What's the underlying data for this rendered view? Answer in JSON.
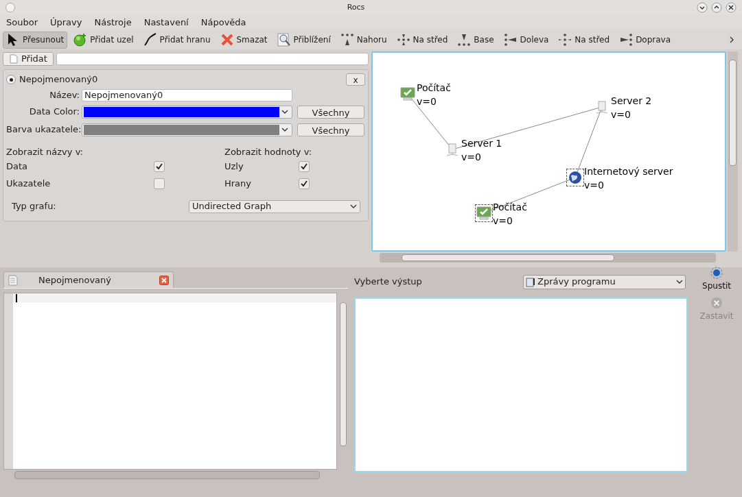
{
  "window": {
    "title": "Rocs"
  },
  "menu": [
    "Soubor",
    "Úpravy",
    "Nástroje",
    "Nastavení",
    "Nápověda"
  ],
  "toolbar": [
    {
      "label": "Přesunout",
      "kind": "pointer",
      "selected": true
    },
    {
      "label": "Přidat uzel",
      "kind": "add-node",
      "selected": false
    },
    {
      "label": "Přidat hranu",
      "kind": "add-edge",
      "selected": false
    },
    {
      "label": "Smazat",
      "kind": "delete",
      "selected": false
    },
    {
      "label": "Přiblížení",
      "kind": "zoom",
      "selected": false
    },
    {
      "label": "Nahoru",
      "kind": "align-top",
      "selected": false
    },
    {
      "label": "Na střed",
      "kind": "align-vcenter",
      "selected": false
    },
    {
      "label": "Base",
      "kind": "align-bottom",
      "selected": false
    },
    {
      "label": "Doleva",
      "kind": "align-left",
      "selected": false
    },
    {
      "label": "Na střed",
      "kind": "align-hcenter",
      "selected": false
    },
    {
      "label": "Doprava",
      "kind": "align-right",
      "selected": false
    }
  ],
  "data_type": {
    "add_button": "Přidat"
  },
  "data_panel": {
    "radio_label": "Nepojmenovaný0",
    "selected": true,
    "close_button": "x",
    "name_label": "Název:",
    "name_value": "Nepojmenovaný0",
    "color_rows": [
      {
        "label": "Data Color:",
        "color": "#0000ff",
        "button": "Všechny"
      },
      {
        "label": "Barva ukazatele:",
        "color": "#808080",
        "button": "Všechny"
      }
    ],
    "names_heading": "Zobrazit názvy v:",
    "names": [
      {
        "label": "Data",
        "checked": true
      },
      {
        "label": "Ukazatele",
        "checked": false
      }
    ],
    "values_heading": "Zobrazit hodnoty v:",
    "values": [
      {
        "label": "Uzly",
        "checked": true
      },
      {
        "label": "Hrany",
        "checked": true
      }
    ],
    "graph_type_label": "Typ grafu:",
    "graph_type": "Undirected Graph"
  },
  "graph": {
    "nodes": [
      {
        "kind": "computer",
        "name": "Počítač",
        "value": "v=0",
        "selected": false
      },
      {
        "kind": "server",
        "name": "Server 1",
        "value": "v=0",
        "selected": false
      },
      {
        "kind": "server",
        "name": "Server 2",
        "value": "v=0",
        "selected": false
      },
      {
        "kind": "globe",
        "name": "Internetový server",
        "value": "v=0",
        "selected": true
      },
      {
        "kind": "computer",
        "name": "Počítač",
        "value": "v=0",
        "selected": true
      }
    ]
  },
  "editor": {
    "tab": "Nepojmenovaný"
  },
  "output": {
    "label": "Vyberte výstup",
    "select": "Zprávy programu"
  },
  "actions": [
    {
      "label": "Spustit",
      "disabled": false
    },
    {
      "label": "Zastavit",
      "disabled": true
    }
  ]
}
